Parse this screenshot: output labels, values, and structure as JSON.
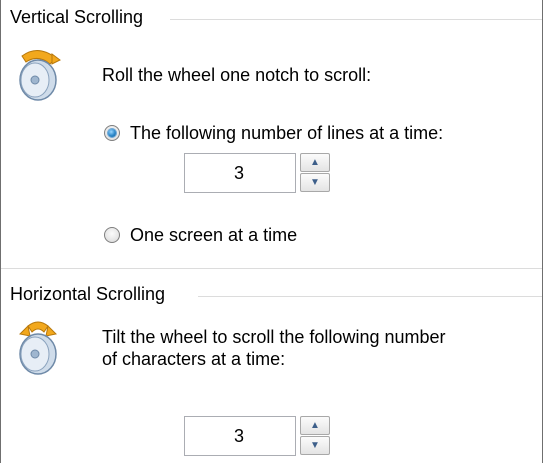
{
  "vertical": {
    "title": "Vertical Scrolling",
    "instruction": "Roll the wheel one notch to scroll:",
    "option_lines_label": "The following number of lines at a time:",
    "option_lines_selected": true,
    "lines_value": "3",
    "option_screen_label": "One screen at a time",
    "option_screen_selected": false,
    "icon": "mouse-wheel-icon"
  },
  "horizontal": {
    "title": "Horizontal Scrolling",
    "instruction_line1": "Tilt the wheel to scroll the following number",
    "instruction_line2": "of characters at a time:",
    "chars_value": "3",
    "icon": "mouse-wheel-tilt-icon"
  },
  "spinner_icons": {
    "up": "▲",
    "down": "▼"
  },
  "colors": {
    "accent": "#2a86c8",
    "wheel_amber": "#f2a81d",
    "wheel_body": "#bcd0e6"
  }
}
